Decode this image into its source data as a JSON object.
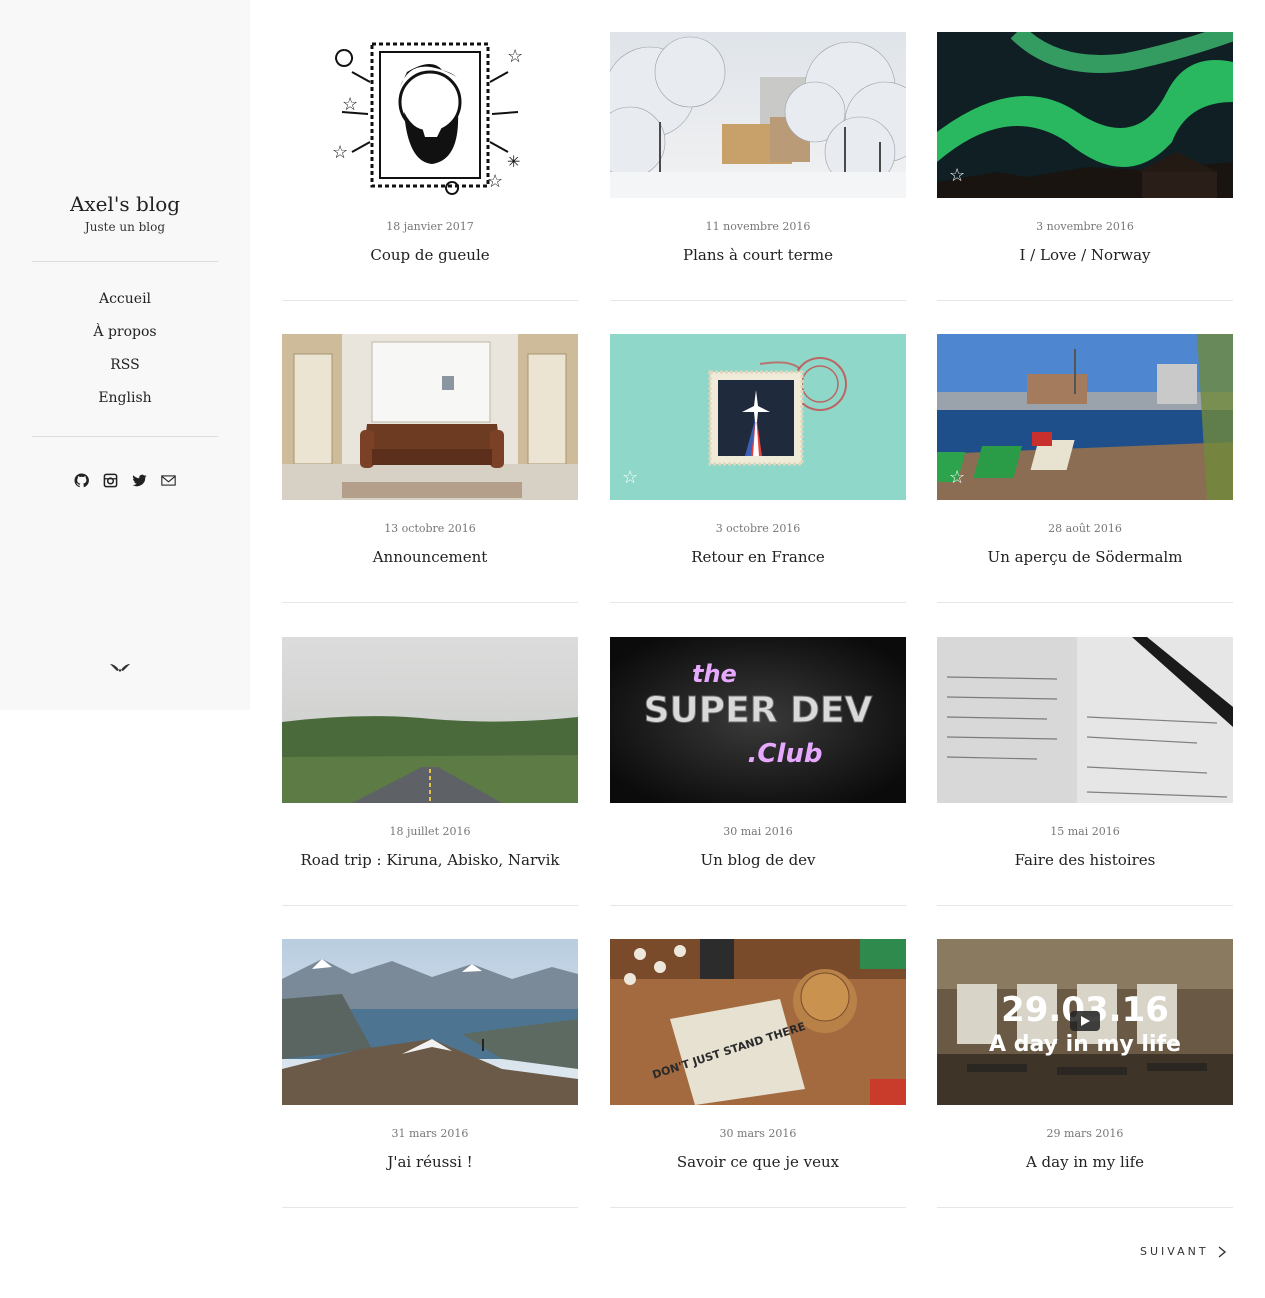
{
  "sidebar": {
    "title": "Axel's blog",
    "subtitle": "Juste un blog",
    "nav": [
      "Accueil",
      "À propos",
      "RSS",
      "English"
    ],
    "social_icons": [
      "github-icon",
      "instagram-icon",
      "twitter-icon",
      "mail-icon"
    ],
    "logo_icon": "wings-logo-icon",
    "background": "#f8f8f8"
  },
  "posts": [
    {
      "date": "18 janvier 2017",
      "title": "Coup de gueule",
      "featured": false,
      "image": "comic-bearded-man"
    },
    {
      "date": "11 novembre 2016",
      "title": "Plans à court terme",
      "featured": false,
      "image": "snowy-trees"
    },
    {
      "date": "3 novembre 2016",
      "title": "I / Love / Norway",
      "featured": true,
      "image": "aurora-borealis"
    },
    {
      "date": "13 octobre 2016",
      "title": "Announcement",
      "featured": false,
      "image": "leather-sofa-room"
    },
    {
      "date": "3 octobre 2016",
      "title": "Retour en France",
      "featured": true,
      "image": "airplane-stamp"
    },
    {
      "date": "28 août 2016",
      "title": "Un aperçu de Södermalm",
      "featured": true,
      "image": "harbor-deckchairs"
    },
    {
      "date": "18 juillet 2016",
      "title": "Road trip : Kiruna, Abisko, Narvik",
      "featured": false,
      "image": "misty-road"
    },
    {
      "date": "30 mai 2016",
      "title": "Un blog de dev",
      "featured": false,
      "image": "super-dev-club-neon"
    },
    {
      "date": "15 mai 2016",
      "title": "Faire des histoires",
      "featured": false,
      "image": "handwritten-notebook"
    },
    {
      "date": "31 mars 2016",
      "title": "J'ai réussi !",
      "featured": false,
      "image": "mountain-lake-hiker"
    },
    {
      "date": "30 mars 2016",
      "title": "Savoir ce que je veux",
      "featured": false,
      "image": "desk-notebook-dont-just-stand-there"
    },
    {
      "date": "29 mars 2016",
      "title": "A day in my life",
      "featured": false,
      "image": "office-video-thumbnail"
    }
  ],
  "image_text": {
    "super_dev_the": "the",
    "super_dev_main": "SUPER DEV",
    "super_dev_club": ".Club",
    "notebook_print": "DON'T JUST STAND THERE",
    "video_date": "29.03.16",
    "video_caption": "A day in my life"
  },
  "pagination": {
    "next_label": "SUIVANT",
    "icon": "chevron-right-icon"
  }
}
